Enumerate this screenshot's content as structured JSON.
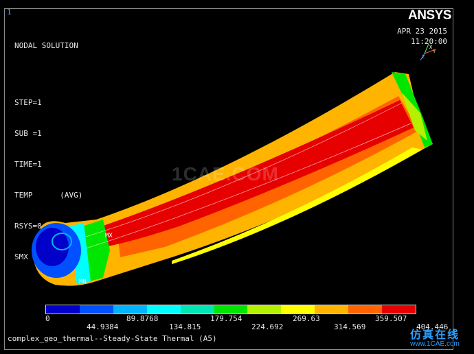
{
  "window_number": "1",
  "info": {
    "heading": "NODAL SOLUTION",
    "step": "STEP=1",
    "sub": "SUB =1",
    "time": "TIME=1",
    "temp": "TEMP      (AVG)",
    "rsys": "RSYS=0",
    "smx": "SMX =404.446"
  },
  "logo": {
    "text_main": "ANSYS"
  },
  "date": {
    "line1": "APR 23 2015",
    "line2": "11:20:00"
  },
  "triad_labels": [
    "X",
    "Y",
    "Z"
  ],
  "markers": {
    "max": "MX",
    "min": "MN"
  },
  "legend": {
    "colors": [
      "#0000c8",
      "#0050ff",
      "#00b4ff",
      "#00ffff",
      "#00e6b4",
      "#00e600",
      "#b4f000",
      "#ffff00",
      "#ffb400",
      "#ff6400",
      "#e60000"
    ],
    "top_values": [
      "0",
      "89.8768",
      "179.754",
      "269.63",
      "359.507"
    ],
    "bottom_values": [
      "44.9384",
      "134.815",
      "224.692",
      "314.569",
      "404.446"
    ]
  },
  "plot_title": "complex_geo_thermal--Steady-State Thermal (A5)",
  "watermark": {
    "text": "1CAE.COM",
    "cn": "仿真在线",
    "url": "www.1CAE.com"
  }
}
